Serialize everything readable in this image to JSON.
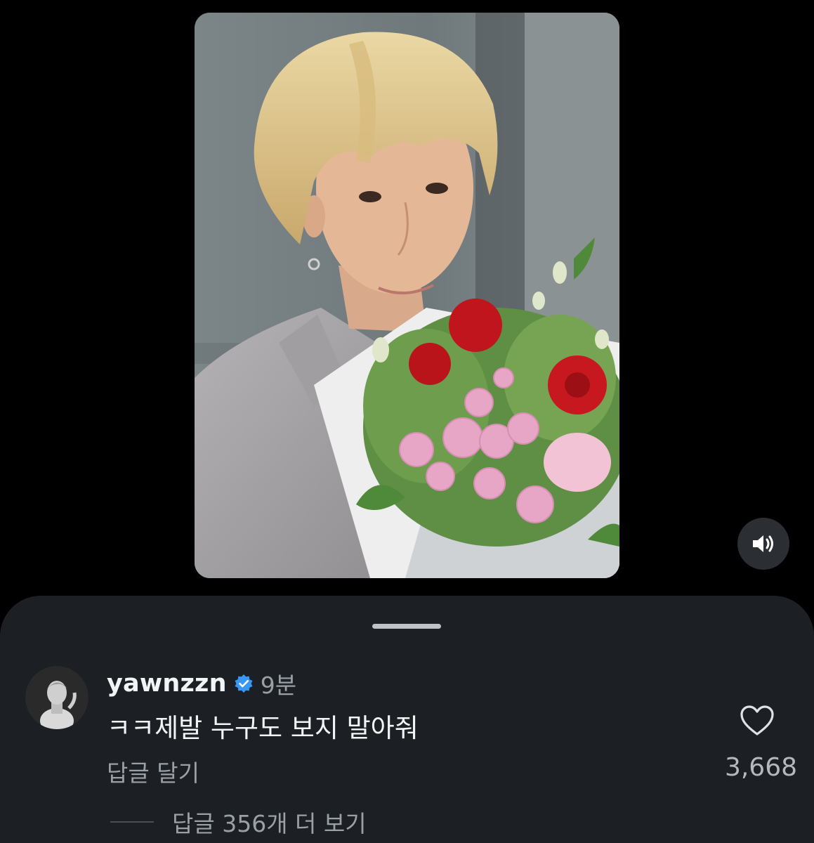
{
  "media": {
    "icon": "video-thumbnail",
    "mute_icon": "speaker-volume-icon"
  },
  "comment": {
    "username": "yawnzzn",
    "verified_icon": "verified-badge-icon",
    "time": "9분",
    "text": "ㅋㅋ제발 누구도 보지 말아줘",
    "reply_label": "답글 달기",
    "like_icon": "heart-outline-icon",
    "like_count": "3,668",
    "more_replies_label": "답글 356개 더 보기"
  },
  "colors": {
    "background": "#000000",
    "sheet": "#1c2025",
    "verified": "#3897f0",
    "primary_text": "#f2f4f5",
    "secondary_text": "#9aa0a6"
  }
}
